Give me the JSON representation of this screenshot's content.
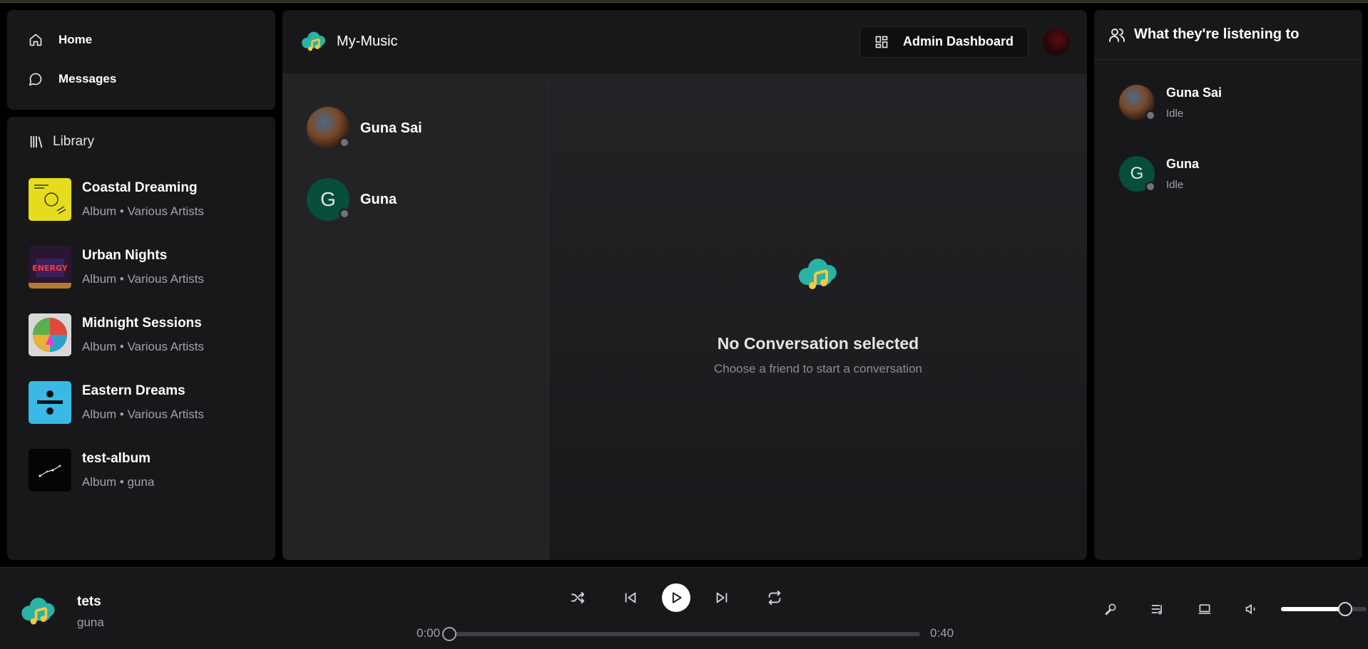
{
  "app": {
    "name": "My-Music"
  },
  "nav": {
    "home": "Home",
    "messages": "Messages"
  },
  "library": {
    "title": "Library",
    "albums": [
      {
        "title": "Coastal Dreaming",
        "subtitle": "Album • Various Artists",
        "cover": "yellow-graphic"
      },
      {
        "title": "Urban Nights",
        "subtitle": "Album • Various Artists",
        "cover": "energy-poster"
      },
      {
        "title": "Midnight Sessions",
        "subtitle": "Album • Various Artists",
        "cover": "colorful-lens"
      },
      {
        "title": "Eastern Dreams",
        "subtitle": "Album • Various Artists",
        "cover": "blue-divide"
      },
      {
        "title": "test-album",
        "subtitle": "Album • guna",
        "cover": "dark-stars"
      }
    ]
  },
  "header": {
    "admin_label": "Admin Dashboard"
  },
  "friends": [
    {
      "name": "Guna Sai",
      "avatar": "image"
    },
    {
      "name": "Guna",
      "avatar": "letter",
      "initial": "G"
    }
  ],
  "empty": {
    "title": "No Conversation selected",
    "subtitle": "Choose a friend to start a conversation"
  },
  "activity": {
    "title": "What they're listening to",
    "users": [
      {
        "name": "Guna Sai",
        "status": "Idle",
        "avatar": "image"
      },
      {
        "name": "Guna",
        "status": "Idle",
        "avatar": "letter",
        "initial": "G"
      }
    ]
  },
  "player": {
    "title": "tets",
    "artist": "guna",
    "current_time": "0:00",
    "duration": "0:40",
    "progress": 0,
    "volume": 0.75
  },
  "colors": {
    "accent_teal": "#2ab3a4",
    "accent_yellow": "#f5c842",
    "avatar_green": "#064e3b"
  }
}
